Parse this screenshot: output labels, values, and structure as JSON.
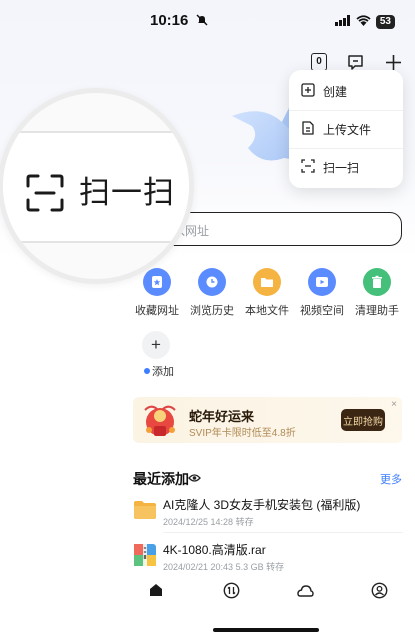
{
  "status_bar": {
    "time": "10:16",
    "battery": "53"
  },
  "top_actions": {
    "transfer_count": "0",
    "icons": [
      "count-badge-icon",
      "message-icon",
      "plus-icon"
    ]
  },
  "menu": {
    "items": [
      {
        "label": "创建",
        "icon": "create-icon"
      },
      {
        "label": "上传文件",
        "icon": "upload-file-icon"
      },
      {
        "label": "扫一扫",
        "icon": "scan-icon"
      }
    ]
  },
  "magnifier": {
    "label": "扫一扫",
    "icon": "scan-icon"
  },
  "search": {
    "placeholder": "入网址"
  },
  "tools": {
    "items": [
      {
        "label": "收藏网址",
        "color": "#5b8cff",
        "icon": "star-icon"
      },
      {
        "label": "浏览历史",
        "color": "#5b8cff",
        "icon": "clock-icon"
      },
      {
        "label": "本地文件",
        "color": "#f5b342",
        "icon": "folder-icon"
      },
      {
        "label": "视频空间",
        "color": "#5b8cff",
        "icon": "video-icon"
      },
      {
        "label": "清理助手",
        "color": "#45c07a",
        "icon": "trash-icon"
      }
    ],
    "add_label": "添加"
  },
  "promo": {
    "title": "蛇年好运来",
    "subtitle": "SVIP年卡限时低至4.8折",
    "button": "立即抢购",
    "close": "×"
  },
  "recent": {
    "title": "最近添加",
    "more": "更多",
    "files": [
      {
        "name": "AI克隆人 3D女友手机安装包 (福利版)",
        "meta": "2024/12/25 14:28 转存",
        "icon": "folder-icon"
      },
      {
        "name": "4K-1080.高清版.rar",
        "meta": "2024/02/21 20:43 5.3 GB 转存",
        "icon": "archive-icon"
      }
    ]
  },
  "bottom_nav": {
    "items": [
      "home-icon",
      "transfer-icon",
      "cloud-icon",
      "profile-icon"
    ]
  }
}
